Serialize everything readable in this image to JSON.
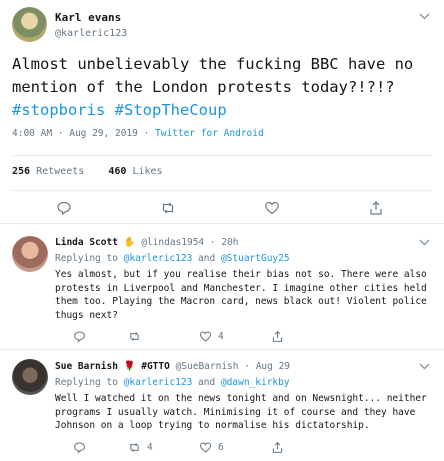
{
  "main_tweet": {
    "author": "Karl evans",
    "handle": "@karleric123",
    "text": "Almost unbelievably the fucking BBC  have no mention of the London protests today?!?!?",
    "hashtags": [
      "#stopboris",
      "#StopTheCoup"
    ],
    "time": "4:00 AM",
    "date": "Aug 29, 2019",
    "source": "Twitter for Android",
    "retweets_count": "256",
    "retweets_label": "Retweets",
    "likes_count": "460",
    "likes_label": "Likes"
  },
  "replies": [
    {
      "author": "Linda Scott",
      "emoji": "✋",
      "handle": "@lindas1954",
      "time": "20h",
      "replying_label": "Replying to",
      "replying_to_1": "@karleric123",
      "replying_and": "and",
      "replying_to_2": "@StuartGuy25",
      "text": "Yes almost, but if you realise their bias not so. There were also protests in Liverpool and Manchester. I imagine other cities held them too. Playing the Macron card, news black out!  Violent police thugs next?",
      "retweets": "",
      "likes": "4"
    },
    {
      "author": "Sue Barnish",
      "emoji": "🌹",
      "tag": "#GTTO",
      "handle": "@SueBarnish",
      "time": "Aug 29",
      "replying_label": "Replying to",
      "replying_to_1": "@karleric123",
      "replying_and": "and",
      "replying_to_2": "@dawn_kirkby",
      "text": "Well I watched it on the news tonight and on Newsnight... neither programs I usually watch. Minimising it of course and they have Johnson on a loop trying to normalise his dictatorship.",
      "retweets": "4",
      "likes": "6"
    }
  ],
  "icons": {
    "reply": "reply-icon",
    "retweet": "retweet-icon",
    "like": "heart-icon",
    "share": "share-icon",
    "more": "chevron-down-icon"
  },
  "colors": {
    "link": "#1b95e0",
    "muted": "#657786",
    "rose": "#c0392b"
  }
}
